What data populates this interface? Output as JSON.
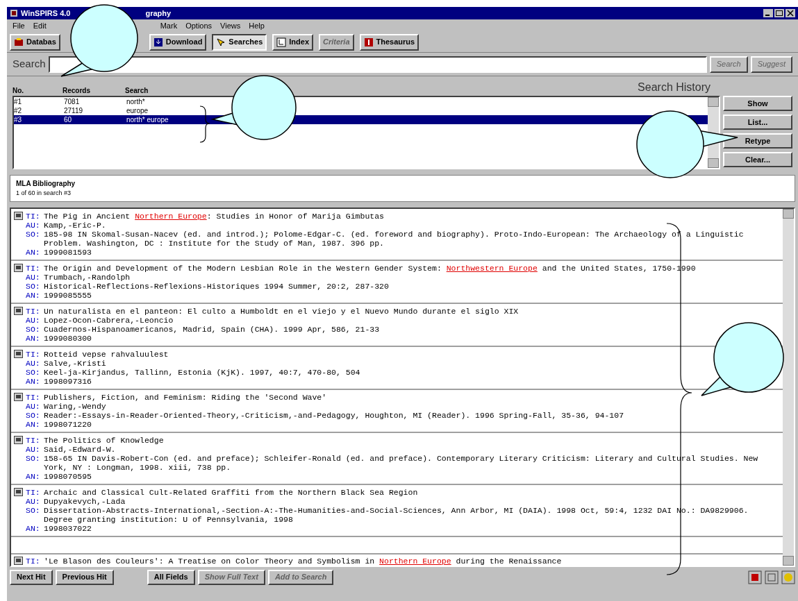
{
  "window": {
    "title_parts": [
      "WinSPIRS 4.0",
      "graphy"
    ]
  },
  "menu": {
    "left": [
      "File",
      "Edit"
    ],
    "right": [
      "Mark",
      "Options",
      "Views",
      "Help"
    ]
  },
  "toolbar": [
    {
      "label": "Databas",
      "disabled": false,
      "selected": false
    },
    {
      "label": "Download",
      "disabled": false,
      "selected": false
    },
    {
      "label": "Searches",
      "disabled": false,
      "selected": true
    },
    {
      "label": "Index",
      "disabled": false,
      "selected": false
    },
    {
      "label": "Criteria",
      "disabled": true,
      "selected": false
    },
    {
      "label": "Thesaurus",
      "disabled": false,
      "selected": false
    }
  ],
  "search": {
    "label": "Search",
    "buttons": [
      {
        "label": "Search",
        "disabled": true
      },
      {
        "label": "Suggest",
        "disabled": true
      }
    ]
  },
  "history": {
    "title": "Search History",
    "columns": [
      "No.",
      "Records",
      "Search"
    ],
    "rows": [
      {
        "no": "#1",
        "records": "7081",
        "search": "north*",
        "selected": false
      },
      {
        "no": "#2",
        "records": "27119",
        "search": "europe",
        "selected": false
      },
      {
        "no": "#3",
        "records": "60",
        "search": "north* europe",
        "selected": true
      }
    ],
    "buttons": [
      "Show",
      "List...",
      "Retype",
      "Clear..."
    ]
  },
  "results": {
    "database": "MLA Bibliography",
    "status": "1 of 60 in search #3",
    "records": [
      {
        "fields": [
          {
            "label": "TI:",
            "parts": [
              {
                "text": "The Pig in Ancient ",
                "hit": false
              },
              {
                "text": "Northern Europe",
                "hit": true
              },
              {
                "text": ": Studies in Honor of Marija Gimbutas",
                "hit": false
              }
            ]
          },
          {
            "label": "AU:",
            "parts": [
              {
                "text": "Kamp,-Eric-P.",
                "hit": false
              }
            ]
          },
          {
            "label": "SO:",
            "parts": [
              {
                "text": "185-98 IN Skomal-Susan-Nacev (ed. and introd.); Polome-Edgar-C. (ed. foreword and biography). Proto-Indo-European: The Archaeology of a Linguistic Problem. Washington, DC : Institute for the Study of Man, 1987. 396 pp.",
                "hit": false
              }
            ]
          },
          {
            "label": "AN:",
            "parts": [
              {
                "text": "1999081593",
                "hit": false
              }
            ]
          }
        ]
      },
      {
        "fields": [
          {
            "label": "TI:",
            "parts": [
              {
                "text": "The Origin and Development of the Modern Lesbian Role in the Western Gender System: ",
                "hit": false
              },
              {
                "text": "Northwestern Europe",
                "hit": true
              },
              {
                "text": " and the United States, 1750-1990",
                "hit": false
              }
            ]
          },
          {
            "label": "AU:",
            "parts": [
              {
                "text": "Trumbach,-Randolph",
                "hit": false
              }
            ]
          },
          {
            "label": "SO:",
            "parts": [
              {
                "text": "Historical-Reflections-Reflexions-Historiques 1994 Summer, 20:2, 287-320",
                "hit": false
              }
            ]
          },
          {
            "label": "AN:",
            "parts": [
              {
                "text": "1999085555",
                "hit": false
              }
            ]
          }
        ]
      },
      {
        "fields": [
          {
            "label": "TI:",
            "parts": [
              {
                "text": "Un naturalista en el panteon: El culto a Humboldt en el viejo y el Nuevo Mundo durante el siglo XIX",
                "hit": false
              }
            ]
          },
          {
            "label": "AU:",
            "parts": [
              {
                "text": "Lopez-Ocon-Cabrera,-Leoncio",
                "hit": false
              }
            ]
          },
          {
            "label": "SO:",
            "parts": [
              {
                "text": "Cuadernos-Hispanoamericanos, Madrid, Spain (CHA). 1999 Apr, 586, 21-33",
                "hit": false
              }
            ]
          },
          {
            "label": "AN:",
            "parts": [
              {
                "text": "1999080300",
                "hit": false
              }
            ]
          }
        ]
      },
      {
        "fields": [
          {
            "label": "TI:",
            "parts": [
              {
                "text": "Rotteid vepse rahvaluulest",
                "hit": false
              }
            ]
          },
          {
            "label": "AU:",
            "parts": [
              {
                "text": "Salve,-Kristi",
                "hit": false
              }
            ]
          },
          {
            "label": "SO:",
            "parts": [
              {
                "text": "Keel-ja-Kirjandus, Tallinn, Estonia (KjK). 1997, 40:7, 470-80, 504",
                "hit": false
              }
            ]
          },
          {
            "label": "AN:",
            "parts": [
              {
                "text": "1998097316",
                "hit": false
              }
            ]
          }
        ]
      },
      {
        "fields": [
          {
            "label": "TI:",
            "parts": [
              {
                "text": "Publishers, Fiction, and Feminism: Riding the 'Second Wave'",
                "hit": false
              }
            ]
          },
          {
            "label": "AU:",
            "parts": [
              {
                "text": "Waring,-Wendy",
                "hit": false
              }
            ]
          },
          {
            "label": "SO:",
            "parts": [
              {
                "text": "Reader:-Essays-in-Reader-Oriented-Theory,-Criticism,-and-Pedagogy, Houghton, MI (Reader). 1996 Spring-Fall, 35-36, 94-107",
                "hit": false
              }
            ]
          },
          {
            "label": "AN:",
            "parts": [
              {
                "text": "1998071220",
                "hit": false
              }
            ]
          }
        ]
      },
      {
        "fields": [
          {
            "label": "TI:",
            "parts": [
              {
                "text": "The Politics of Knowledge",
                "hit": false
              }
            ]
          },
          {
            "label": "AU:",
            "parts": [
              {
                "text": "Said,-Edward-W.",
                "hit": false
              }
            ]
          },
          {
            "label": "SO:",
            "parts": [
              {
                "text": "158-65 IN Davis-Robert-Con (ed. and preface); Schleifer-Ronald (ed. and preface). Contemporary Literary Criticism: Literary and Cultural Studies. New York, NY : Longman, 1998. xiii, 738 pp.",
                "hit": false
              }
            ]
          },
          {
            "label": "AN:",
            "parts": [
              {
                "text": "1998070595",
                "hit": false
              }
            ]
          }
        ]
      },
      {
        "fields": [
          {
            "label": "TI:",
            "parts": [
              {
                "text": "Archaic and Classical Cult-Related Graffiti from the Northern Black Sea Region",
                "hit": false
              }
            ]
          },
          {
            "label": "AU:",
            "parts": [
              {
                "text": "Dupyakevych,-Lada",
                "hit": false
              }
            ]
          },
          {
            "label": "SO:",
            "parts": [
              {
                "text": "Dissertation-Abstracts-International,-Section-A:-The-Humanities-and-Social-Sciences, Ann Arbor, MI (DAIA). 1998 Oct, 59:4, 1232 DAI No.: DA9829906. Degree granting institution: U of Pennsylvania, 1998",
                "hit": false
              }
            ]
          },
          {
            "label": "AN:",
            "parts": [
              {
                "text": "1998037022",
                "hit": false
              }
            ]
          }
        ]
      },
      {
        "fields": [
          {
            "label": "TI:",
            "parts": [
              {
                "text": "'Le Blason des Couleurs': A Treatise on Color Theory and Symbolism in ",
                "hit": false
              },
              {
                "text": "Northern Europe",
                "hit": true
              },
              {
                "text": " during the Renaissance",
                "hit": false
              }
            ]
          }
        ]
      }
    ]
  },
  "bottom_buttons": [
    {
      "label": "Next Hit",
      "disabled": false
    },
    {
      "label": "Previous Hit",
      "disabled": false
    },
    {
      "label": "All Fields",
      "disabled": false
    },
    {
      "label": "Show Full Text",
      "disabled": true
    },
    {
      "label": "Add to Search",
      "disabled": true
    }
  ]
}
